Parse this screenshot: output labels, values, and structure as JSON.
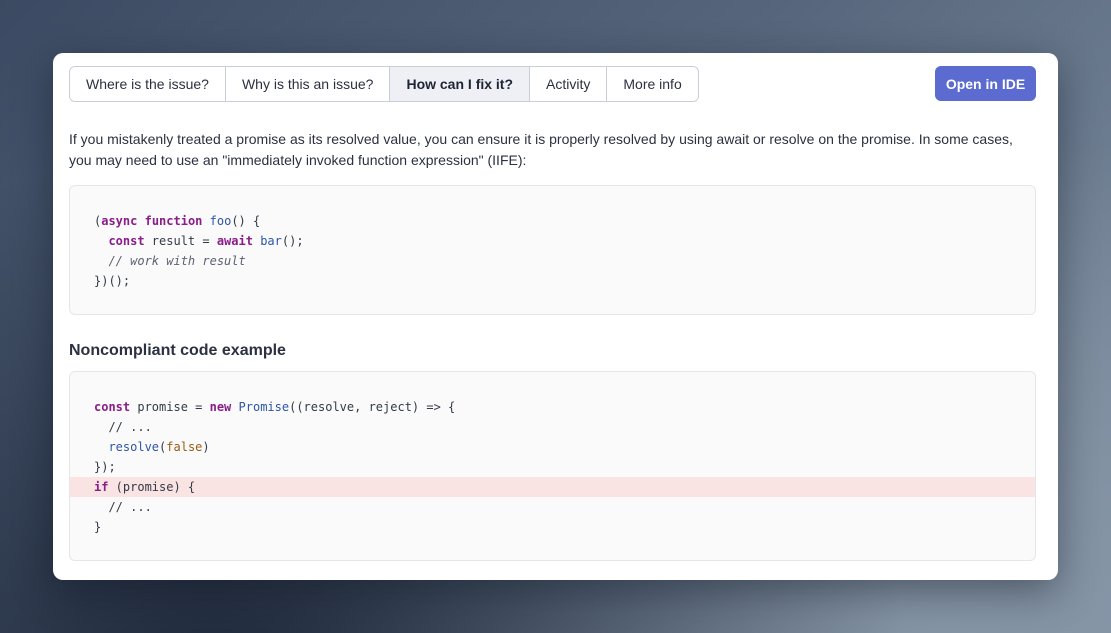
{
  "tabs": [
    {
      "label": "Where is the issue?",
      "active": false
    },
    {
      "label": "Why is this an issue?",
      "active": false
    },
    {
      "label": "How can I fix it?",
      "active": true
    },
    {
      "label": "Activity",
      "active": false
    },
    {
      "label": "More info",
      "active": false
    }
  ],
  "open_ide_label": "Open in IDE",
  "intro_text": "If you mistakenly treated a promise as its resolved value, you can ensure it is properly resolved by using await or resolve on the promise. In some cases, you may need to use an \"immediately invoked function expression\" (IIFE):",
  "compliant_code": [
    [
      {
        "t": "(",
        "c": ""
      },
      {
        "t": "async",
        "c": "kw"
      },
      {
        "t": " ",
        "c": ""
      },
      {
        "t": "function",
        "c": "kw"
      },
      {
        "t": " ",
        "c": ""
      },
      {
        "t": "foo",
        "c": "fn"
      },
      {
        "t": "() {",
        "c": ""
      }
    ],
    [
      {
        "t": "  ",
        "c": ""
      },
      {
        "t": "const",
        "c": "kw"
      },
      {
        "t": " result = ",
        "c": ""
      },
      {
        "t": "await",
        "c": "kw"
      },
      {
        "t": " ",
        "c": ""
      },
      {
        "t": "bar",
        "c": "fn"
      },
      {
        "t": "();",
        "c": ""
      }
    ],
    [
      {
        "t": "  ",
        "c": ""
      },
      {
        "t": "// work with result",
        "c": "cm"
      }
    ],
    [
      {
        "t": "})();",
        "c": ""
      }
    ]
  ],
  "noncompliant_title": "Noncompliant code example",
  "noncompliant_code": [
    {
      "highlight": false,
      "tokens": [
        {
          "t": "const",
          "c": "kw"
        },
        {
          "t": " promise = ",
          "c": ""
        },
        {
          "t": "new",
          "c": "kw"
        },
        {
          "t": " ",
          "c": ""
        },
        {
          "t": "Promise",
          "c": "fn"
        },
        {
          "t": "((resolve, reject) => {",
          "c": ""
        }
      ]
    },
    {
      "highlight": false,
      "tokens": [
        {
          "t": "  ",
          "c": ""
        },
        {
          "t": "// ...",
          "c": ""
        }
      ]
    },
    {
      "highlight": false,
      "tokens": [
        {
          "t": "  ",
          "c": ""
        },
        {
          "t": "resolve",
          "c": "fn"
        },
        {
          "t": "(",
          "c": ""
        },
        {
          "t": "false",
          "c": "lit"
        },
        {
          "t": ")",
          "c": ""
        }
      ]
    },
    {
      "highlight": false,
      "tokens": [
        {
          "t": "});",
          "c": ""
        }
      ]
    },
    {
      "highlight": true,
      "tokens": [
        {
          "t": "if",
          "c": "kw"
        },
        {
          "t": " (promise) {",
          "c": ""
        }
      ]
    },
    {
      "highlight": false,
      "tokens": [
        {
          "t": "  ",
          "c": ""
        },
        {
          "t": "// ...",
          "c": ""
        }
      ]
    },
    {
      "highlight": false,
      "tokens": [
        {
          "t": "}",
          "c": ""
        }
      ]
    }
  ],
  "colors": {
    "accent": "#5c6bcf",
    "active_tab_bg": "#eef0f6",
    "highlight_line": "#f9e3e3",
    "keyword": "#8a1d8a",
    "function": "#2e55a8",
    "literal": "#9a5a12"
  }
}
